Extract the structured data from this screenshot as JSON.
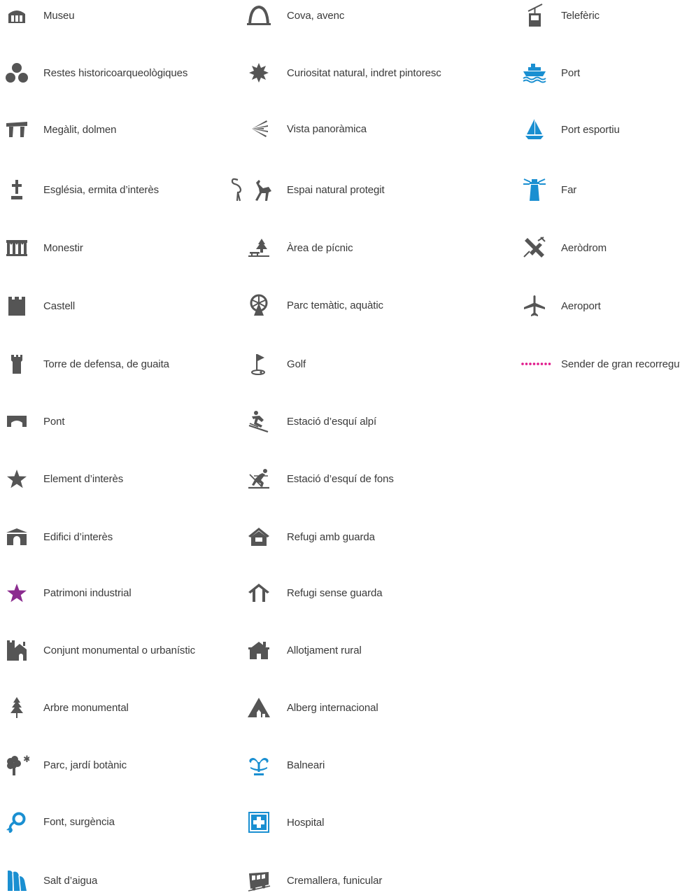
{
  "legend": {
    "col1": [
      {
        "label": "Museu",
        "icon": "museum-icon"
      },
      {
        "label": "Restes historicoarqueològiques",
        "icon": "archaeological-remains-icon"
      },
      {
        "label": "Megàlit, dolmen",
        "icon": "dolmen-icon"
      },
      {
        "label": "Església, ermita d’interès",
        "icon": "church-cross-icon"
      },
      {
        "label": "Monestir",
        "icon": "monastery-icon"
      },
      {
        "label": "Castell",
        "icon": "castle-icon"
      },
      {
        "label": "Torre de defensa, de guaita",
        "icon": "watchtower-icon"
      },
      {
        "label": "Pont",
        "icon": "bridge-icon"
      },
      {
        "label": "Element d’interès",
        "icon": "star-icon"
      },
      {
        "label": "Edifici d’interès",
        "icon": "building-icon"
      },
      {
        "label": "Patrimoni industrial",
        "icon": "industrial-star-icon"
      },
      {
        "label": "Conjunt monumental o urbanístic",
        "icon": "monumental-ensemble-icon"
      },
      {
        "label": "Arbre monumental",
        "icon": "conifer-tree-icon"
      },
      {
        "label": "Parc, jardí botànic",
        "icon": "park-tree-icon"
      },
      {
        "label": "Font, surgència",
        "icon": "spring-icon"
      },
      {
        "label": "Salt d’aigua",
        "icon": "waterfall-icon"
      }
    ],
    "col2": [
      {
        "label": "Cova, avenc",
        "icon": "cave-icon"
      },
      {
        "label": "Curiositat natural, indret pintoresc",
        "icon": "natural-curiosity-icon"
      },
      {
        "label": "Vista panoràmica",
        "icon": "panoramic-view-icon"
      },
      {
        "label": "Espai natural protegit",
        "icon": "protected-nature-icon"
      },
      {
        "label": "Àrea de pícnic",
        "icon": "picnic-icon"
      },
      {
        "label": "Parc temàtic, aquàtic",
        "icon": "ferris-wheel-icon"
      },
      {
        "label": "Golf",
        "icon": "golf-icon"
      },
      {
        "label": "Estació d’esquí alpí",
        "icon": "alpine-ski-icon"
      },
      {
        "label": "Estació d’esquí de fons",
        "icon": "cross-country-ski-icon"
      },
      {
        "label": "Refugi amb guarda",
        "icon": "staffed-refuge-icon"
      },
      {
        "label": "Refugi sense guarda",
        "icon": "unstaffed-refuge-icon"
      },
      {
        "label": "Allotjament rural",
        "icon": "rural-lodging-icon"
      },
      {
        "label": "Alberg internacional",
        "icon": "hostel-icon"
      },
      {
        "label": "Balneari",
        "icon": "spa-icon"
      },
      {
        "label": "Hospital",
        "icon": "hospital-icon"
      },
      {
        "label": "Cremallera, funicular",
        "icon": "funicular-icon"
      }
    ],
    "col3": [
      {
        "label": "Telefèric",
        "icon": "cable-car-icon"
      },
      {
        "label": "Port",
        "icon": "port-ship-icon"
      },
      {
        "label": "Port esportiu",
        "icon": "sailboat-icon"
      },
      {
        "label": "Far",
        "icon": "lighthouse-icon"
      },
      {
        "label": "Aeròdrom",
        "icon": "aerodrome-icon"
      },
      {
        "label": "Aeroport",
        "icon": "airport-icon"
      },
      {
        "label": "Sender de gran recorregut",
        "icon": "trail-dots-icon"
      }
    ]
  },
  "colors": {
    "icon_gray": "#555555",
    "text": "#3a3a3a",
    "blue": "#1a8fd1",
    "purple": "#8b2c8f",
    "magenta": "#e0168a"
  }
}
